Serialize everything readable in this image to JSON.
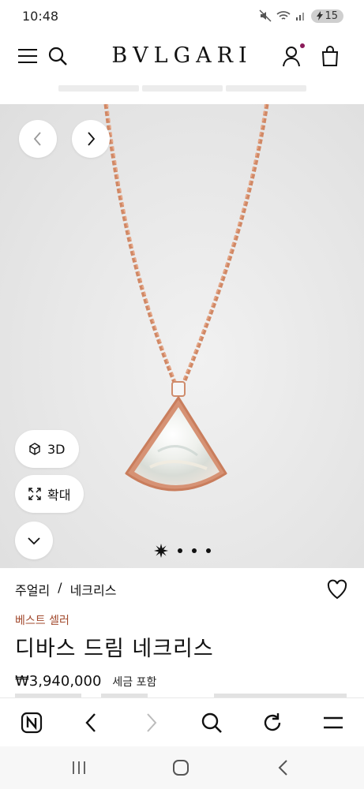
{
  "status_bar": {
    "time": "10:48",
    "battery": "15"
  },
  "header": {
    "brand": "BVLGARI"
  },
  "hero": {
    "prev_icon": "chevron-left-icon",
    "next_icon": "chevron-right-icon",
    "view_3d_label": "3D",
    "zoom_label": "확대",
    "collapse_icon": "chevron-down-icon",
    "carousel_pages": 4,
    "carousel_current": 1
  },
  "product": {
    "breadcrumb": [
      "주얼리",
      "/",
      "네크리스"
    ],
    "badge": "베스트 셀러",
    "title": "디바스 드림 네크리스",
    "price": "₩3,940,000",
    "tax_note": "세금 포함"
  },
  "colors": {
    "badge": "#a24a2e",
    "hero_bg": "#e6e6e6",
    "rose_gold": "#d4896a"
  }
}
